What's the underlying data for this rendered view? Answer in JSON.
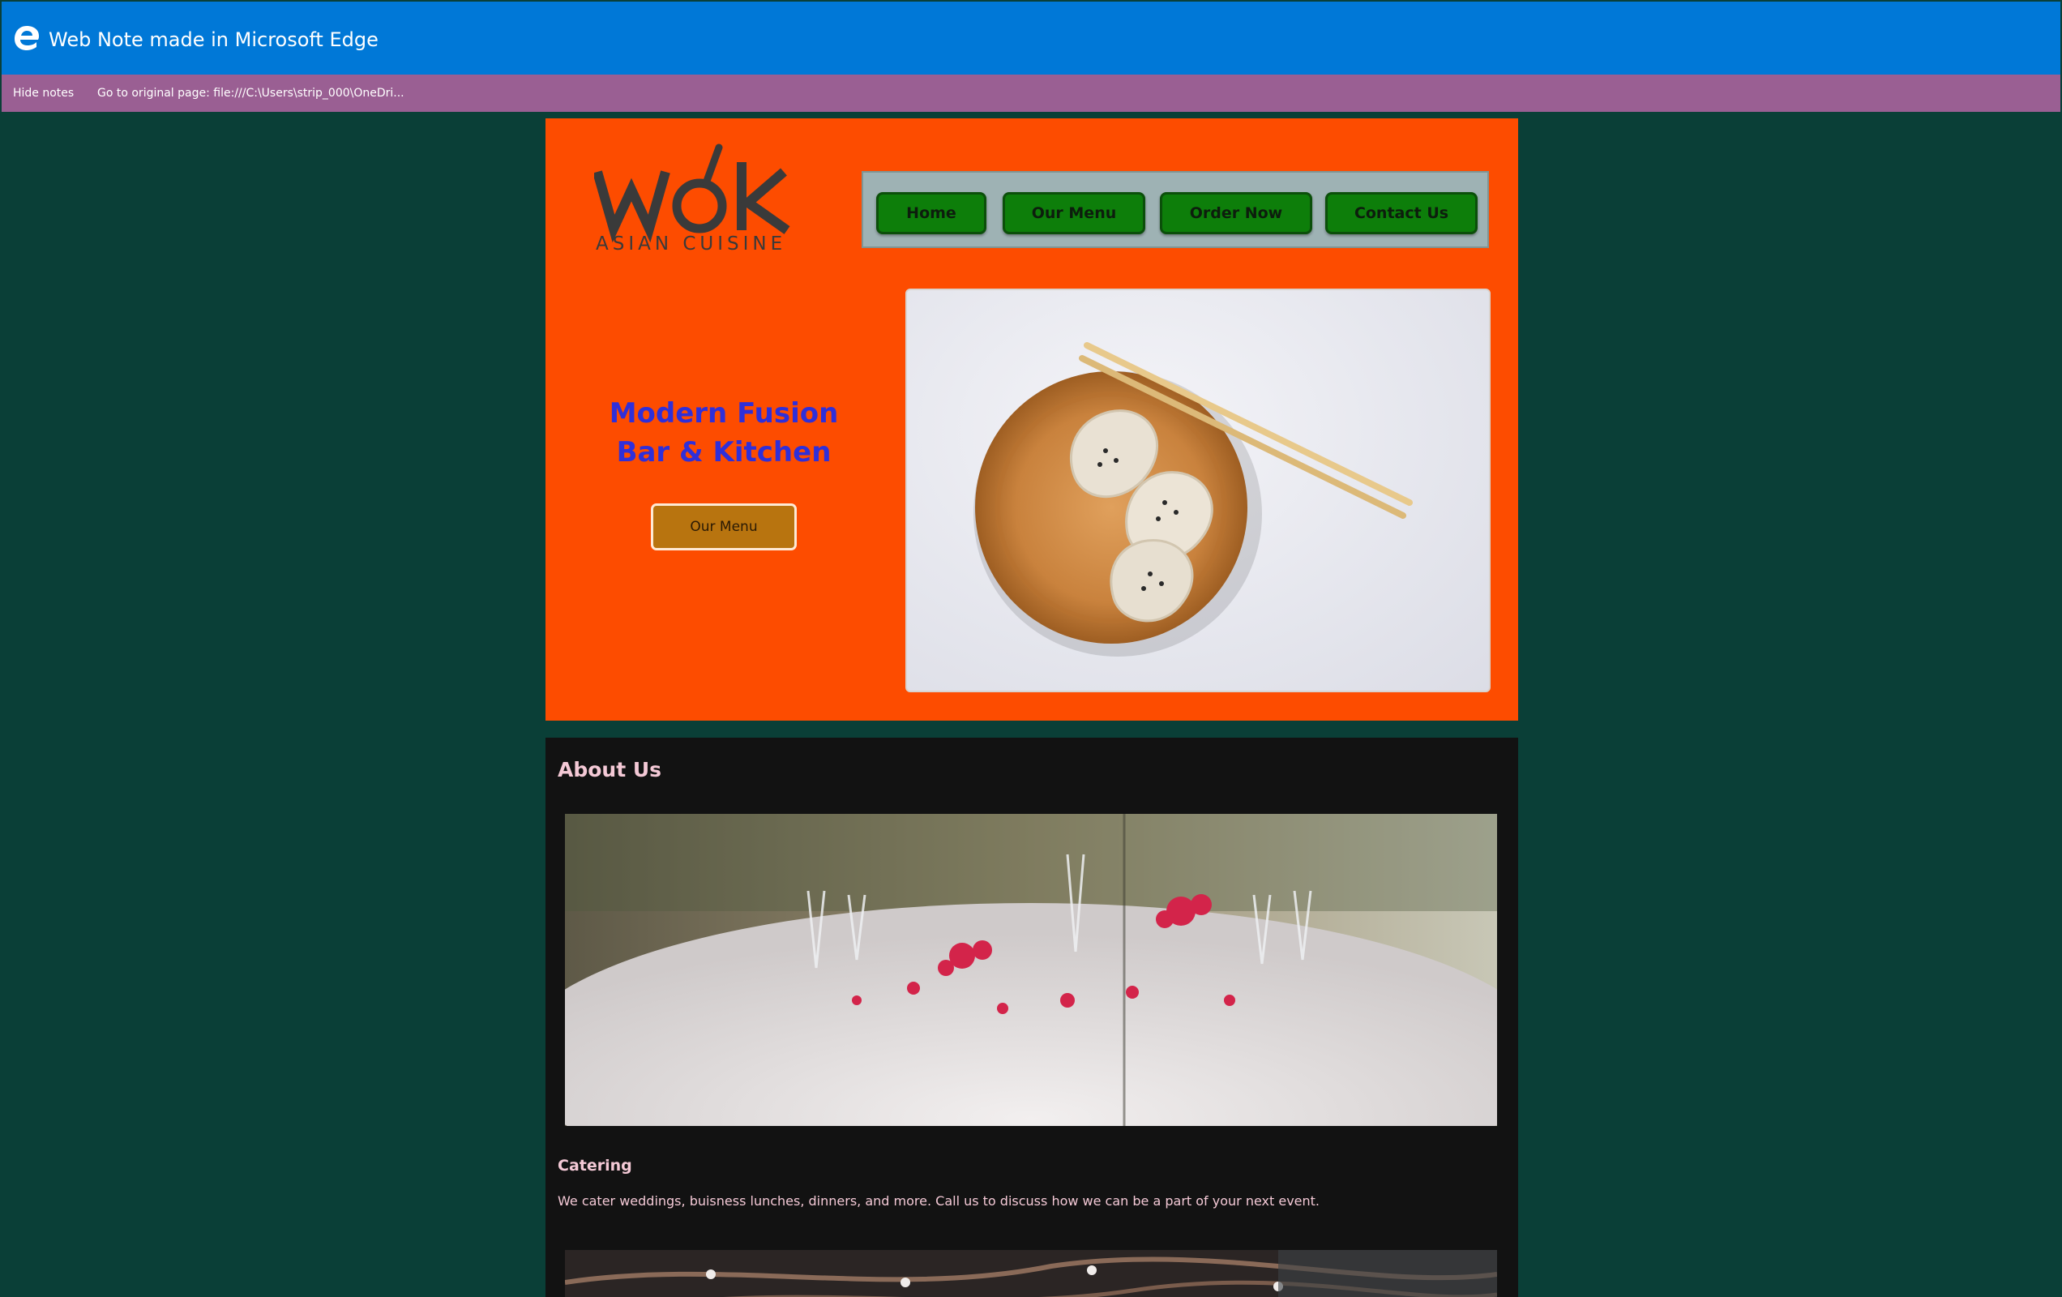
{
  "window": {
    "title": "Web Note made in Microsoft Edge"
  },
  "notes_bar": {
    "hide_label": "Hide notes",
    "goto_label": "Go to original page: file:///C:\\Users\\strip_000\\OneDri..."
  },
  "brand": {
    "logo_word": "WÓK",
    "logo_tagline": "ASIAN CUISINE"
  },
  "nav": {
    "items": [
      {
        "label": "Home"
      },
      {
        "label": "Our Menu"
      },
      {
        "label": "Order Now"
      },
      {
        "label": "Contact Us"
      }
    ]
  },
  "hero": {
    "headline_line1": "Modern Fusion",
    "headline_line2": "Bar & Kitchen",
    "cta_label": "Our Menu"
  },
  "about": {
    "heading": "About Us",
    "catering_title": "Catering",
    "catering_text": "We cater weddings, buisness lunches, dinners, and more. Call us to discuss how we can be a part of your next event."
  },
  "colors": {
    "titlebar": "#0078d7",
    "notesbar": "#9a5f93",
    "page_bg": "#0a3f37",
    "hero_bg": "#fd4c00",
    "nav_button": "#0d7e0a",
    "headline": "#2f2fd9",
    "cta": "#b8740f",
    "about_bg": "#121212",
    "about_text": "#f4c9d6"
  }
}
